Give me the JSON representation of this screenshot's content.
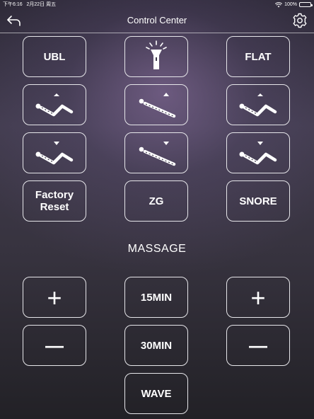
{
  "status_bar": {
    "time": "下午6:16",
    "date": "2月22日 周五",
    "battery": "100%"
  },
  "header": {
    "title": "Control Center"
  },
  "buttons": {
    "ubl": "UBL",
    "flat": "FLAT",
    "factory_reset": "Factory Reset",
    "zg": "ZG",
    "snore": "SNORE"
  },
  "massage": {
    "title": "MASSAGE",
    "plus_left": "+",
    "minus_left": "—",
    "plus_right": "+",
    "minus_right": "—",
    "min15": "15MIN",
    "min30": "30MIN",
    "wave": "WAVE"
  }
}
